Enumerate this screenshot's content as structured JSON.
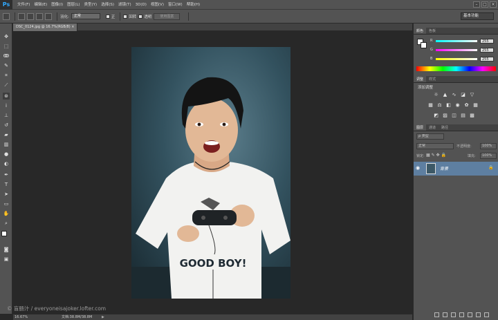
{
  "app": {
    "logo": "Ps"
  },
  "menu": [
    "文件(F)",
    "编辑(E)",
    "图像(I)",
    "图层(L)",
    "类型(Y)",
    "选择(S)",
    "滤镜(T)",
    "3D(D)",
    "视图(V)",
    "窗口(W)",
    "帮助(H)"
  ],
  "window_controls": [
    "–",
    "□",
    "×"
  ],
  "options": {
    "feather_label": "羽化:",
    "feather_value": "正常",
    "opt1": "正",
    "opt2": "回转",
    "opt3": "透明",
    "disabled_button": "使用图案",
    "workspace": "基本功能"
  },
  "document": {
    "tab_title": "DSC_0124.jpg @ 16.7%(RGB/8)",
    "close": "×"
  },
  "image": {
    "shirt_text": "GOOD BOY!",
    "colors": {
      "bg": "#33525f",
      "shirt": "#f2f2f0",
      "skin": "#e2b896",
      "hair": "#141414"
    }
  },
  "watermark": "© 盲肠汁 / everyoneisajoker.lofter.com",
  "status": {
    "zoom": "16.67%",
    "doc_size": "文档:38.8M/38.8M"
  },
  "color_panel": {
    "tabs": [
      "颜色",
      "色板"
    ],
    "channels": [
      {
        "label": "R",
        "value": "255",
        "gradient": "linear-gradient(90deg,#00ffff,#ffffff)"
      },
      {
        "label": "G",
        "value": "255",
        "gradient": "linear-gradient(90deg,#ff00ff,#ffffff)"
      },
      {
        "label": "B",
        "value": "255",
        "gradient": "linear-gradient(90deg,#ffff00,#ffffff)"
      }
    ]
  },
  "adjust_panel": {
    "tabs": [
      "调整",
      "样式"
    ],
    "title": "添加调整"
  },
  "layers_panel": {
    "tabs": [
      "图层",
      "通道",
      "路径"
    ],
    "filter": "ρ 类型",
    "blend": "正常",
    "opacity_label": "不透明度:",
    "opacity": "100%",
    "lock_label": "锁定:",
    "fill_label": "填充:",
    "fill": "100%",
    "layer_name": "背景"
  }
}
